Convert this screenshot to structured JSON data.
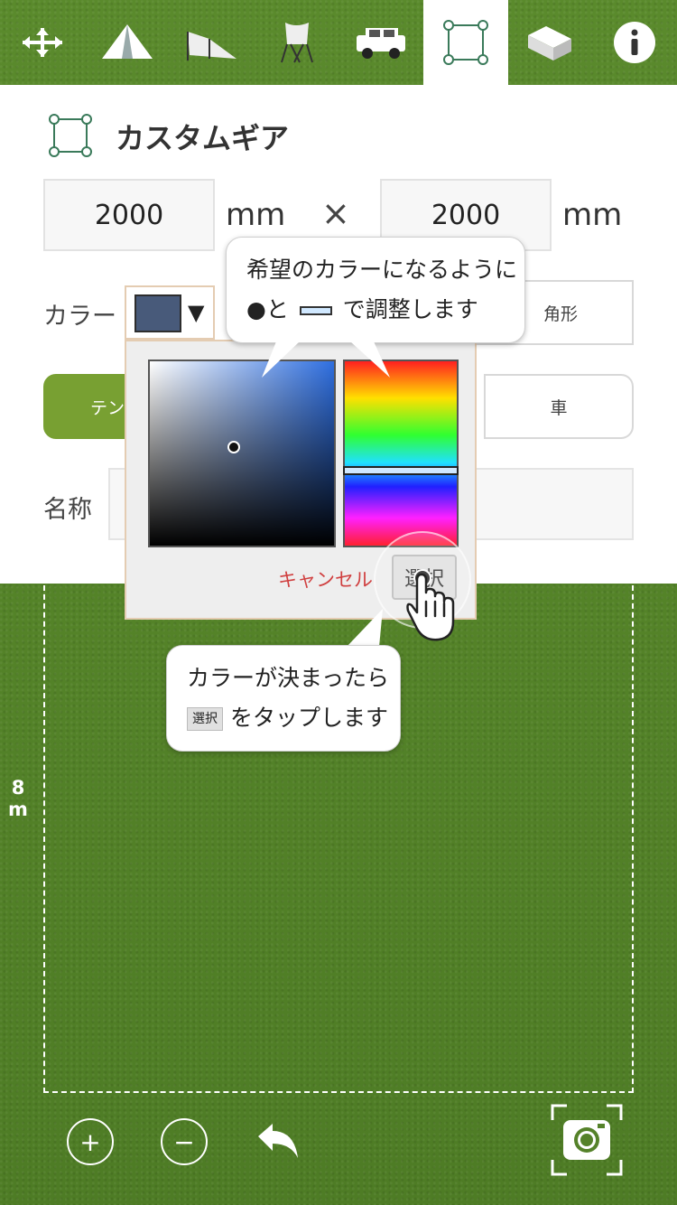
{
  "toolbar": {
    "items": [
      {
        "name": "move-tool",
        "icon": "move-arrows-icon",
        "active": false
      },
      {
        "name": "tent-tool",
        "icon": "tent-icon",
        "active": false
      },
      {
        "name": "tarp-tool",
        "icon": "tarp-icon",
        "active": false
      },
      {
        "name": "chair-tool",
        "icon": "chair-icon",
        "active": false
      },
      {
        "name": "car-tool",
        "icon": "car-icon",
        "active": false
      },
      {
        "name": "custom-gear-tool",
        "icon": "square-shape-icon",
        "active": true
      },
      {
        "name": "box-tool",
        "icon": "box-icon",
        "active": false
      },
      {
        "name": "info-tool",
        "icon": "info-icon",
        "active": false
      }
    ]
  },
  "panel": {
    "title": "カスタムギア",
    "width_value": "2000",
    "height_value": "2000",
    "unit": "mm",
    "times": "×",
    "color_label": "カラー",
    "color_value": "#485a7a",
    "caret": "▼",
    "shape_option_visible": "角形",
    "category_tent_partial": "テン",
    "category_car": "車",
    "name_label": "名称"
  },
  "color_popup": {
    "cancel_label": "キャンセル",
    "select_label": "選択"
  },
  "callout_top": {
    "line1": "希望のカラーになるように",
    "line2_a": "●と",
    "line2_b": "で調整します"
  },
  "callout_bottom": {
    "line1": "カラーが決まったら",
    "button_text": "選択",
    "line2": "をタップします"
  },
  "field": {
    "dimension_digit": "8",
    "dimension_unit": "m"
  },
  "bottom_controls": {
    "zoom_in": "+",
    "zoom_out": "−"
  },
  "colors": {
    "accent_green": "#78a032",
    "grass": "#55822a",
    "cancel_red": "#d04040"
  }
}
